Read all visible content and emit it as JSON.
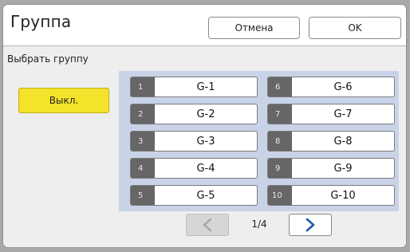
{
  "header": {
    "title": "Группа",
    "cancel_label": "Отмена",
    "ok_label": "OK"
  },
  "panel": {
    "subtitle": "Выбрать группу",
    "off_label": "Выкл."
  },
  "groups": [
    {
      "num": "1",
      "label": "G-1"
    },
    {
      "num": "2",
      "label": "G-2"
    },
    {
      "num": "3",
      "label": "G-3"
    },
    {
      "num": "4",
      "label": "G-4"
    },
    {
      "num": "5",
      "label": "G-5"
    },
    {
      "num": "6",
      "label": "G-6"
    },
    {
      "num": "7",
      "label": "G-7"
    },
    {
      "num": "8",
      "label": "G-8"
    },
    {
      "num": "9",
      "label": "G-9"
    },
    {
      "num": "10",
      "label": "G-10"
    }
  ],
  "pager": {
    "indicator": "1/4",
    "prev_icon": "chevron-left-icon",
    "next_icon": "chevron-right-icon"
  },
  "colors": {
    "off_button": "#f5e22a",
    "grid_panel": "#c9d3e8",
    "number_badge": "#666666",
    "next_arrow": "#1f5fb0"
  }
}
